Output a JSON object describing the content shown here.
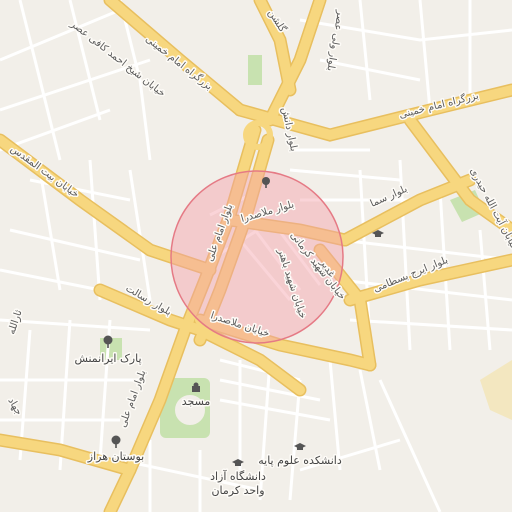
{
  "map": {
    "colors": {
      "background": "#f2efe9",
      "major_road": "#f7d77f",
      "major_road_casing": "#e8bf5f",
      "minor_road": "#ffffff",
      "park": "#c8e2b0",
      "circle_fill": "#f5a0a8",
      "circle_stroke": "#e57a85"
    },
    "road_labels": {
      "imam_khomeini_top": "بزرگراه امام خمینی",
      "imam_khomeini_right": "بزرگراه امام خمینی",
      "kafi": "خیابان شیخ احمد کافی عصر",
      "vali_asr": "بلوار ولی عصر",
      "golshan": "گلشن",
      "danesh": "بلوار دانش",
      "beyt_moghaddas": "خیابان بیت المقدس",
      "molla_sadra_1": "بلوار ملاصدرا",
      "molla_sadra_2": "خیابان ملاصدرا",
      "imam_ali_1": "بلوار امام علی",
      "imam_ali_2": "بلوار امام علی",
      "sama": "بلوار سما",
      "iraj": "بلوار ایرج بسطامی",
      "ayatollah": "خیابان آیت الله حیدری",
      "resalat": "بلوار رسالت",
      "shahid_1": "خیابان شهید کرمانی",
      "shahid_2": "خیابان شهید باهنر",
      "salar": "ثارالله",
      "jahad": "جهاد",
      "ghadir": "غدیر"
    },
    "pois": {
      "park_iranmanesh": "پارک ایرانمنش",
      "mosque": "مسجد",
      "bustan_harraz": "بوستان هراز",
      "faculty": "دانشکده علوم پایه",
      "azad_line1": "دانشگاه آزاد",
      "azad_line2": "واحد کرمان"
    },
    "icons": {
      "park": "tree-icon",
      "mosque": "mosque-icon",
      "school": "graduation-cap-icon",
      "center_marker": "tree-icon"
    }
  }
}
